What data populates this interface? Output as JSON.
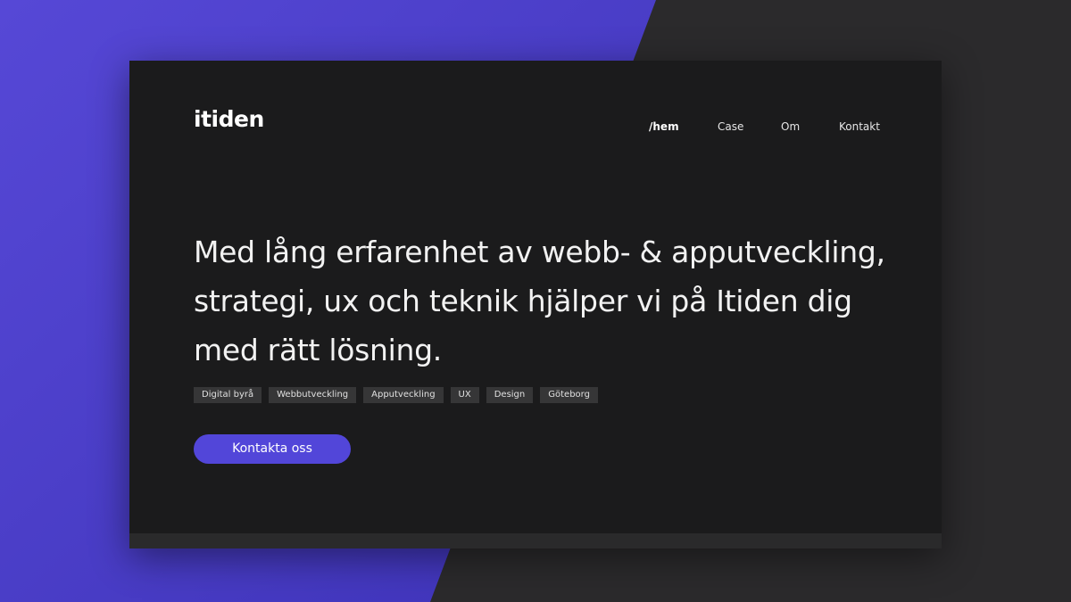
{
  "colors": {
    "accent": "#5246d9",
    "background_dark": "#2b2a2c",
    "panel": "#1b1b1c",
    "tag_bg": "#363637"
  },
  "brand": {
    "logo_text": "itiden"
  },
  "nav": {
    "items": [
      {
        "label": "/hem",
        "active": true
      },
      {
        "label": "Case",
        "active": false
      },
      {
        "label": "Om",
        "active": false
      },
      {
        "label": "Kontakt",
        "active": false
      }
    ]
  },
  "hero": {
    "line1": "Med lång erfarenhet av webb- & apputveckling,",
    "line2": "strategi, ux och teknik hjälper vi på Itiden dig",
    "line3": "med rätt lösning.",
    "tags": [
      "Digital byrå",
      "Webbutveckling",
      "Apputveckling",
      "UX",
      "Design",
      "Göteborg"
    ],
    "cta_label": "Kontakta oss"
  }
}
